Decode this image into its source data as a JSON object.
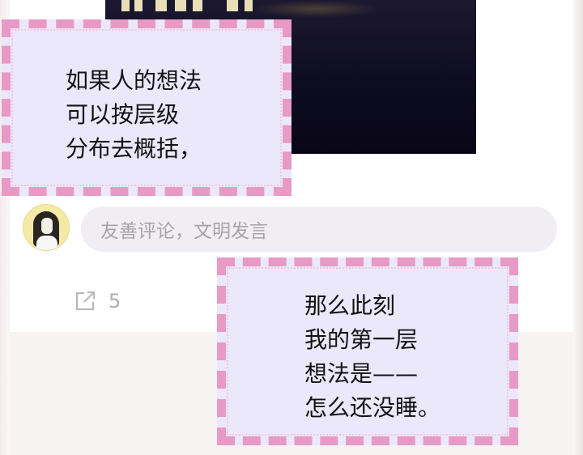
{
  "caption_top": {
    "lines": [
      "如果人的想法",
      "可以按层级",
      "分布去概括，"
    ]
  },
  "comment": {
    "placeholder": "友善评论，文明发言"
  },
  "share": {
    "icon": "share-icon",
    "count": "5"
  },
  "caption_bottom": {
    "lines": [
      "那么此刻",
      "我的第一层",
      "想法是——",
      "怎么还没睡。"
    ]
  },
  "colors": {
    "bubble_border": "#e79ac6",
    "bubble_fill": "#ebe8fb",
    "input_bg": "#f1eef3",
    "placeholder_text": "#a6a2aa"
  }
}
